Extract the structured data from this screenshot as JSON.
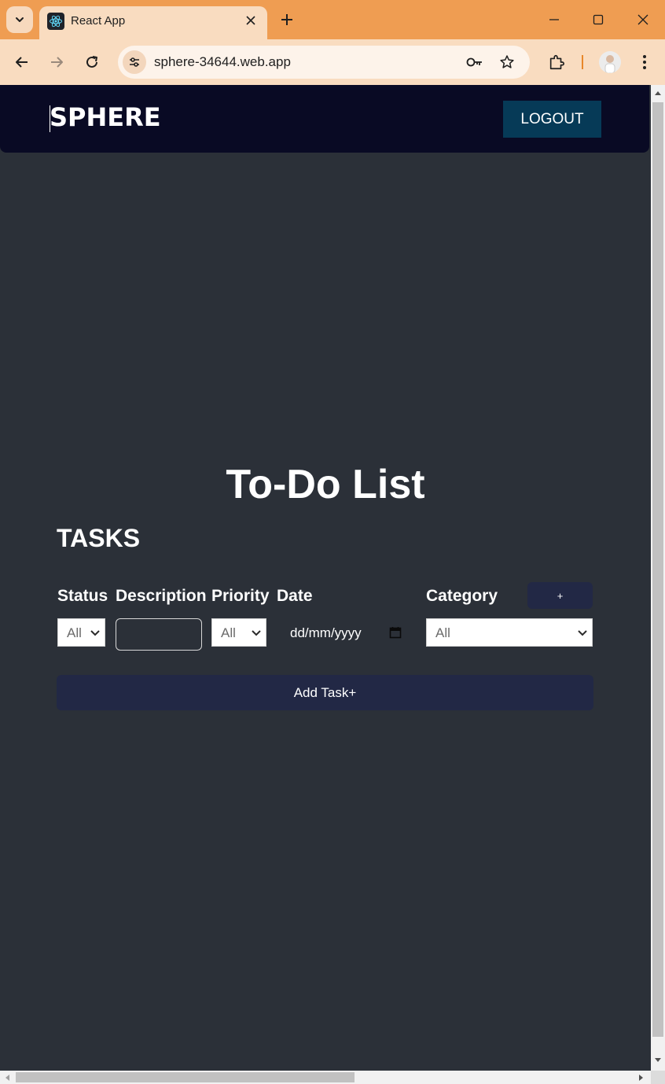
{
  "browser": {
    "tab_title": "React App",
    "url": "sphere-34644.web.app"
  },
  "app": {
    "brand": "SPHERE",
    "logout_label": "LOGOUT",
    "page_title": "To-Do List",
    "tasks_heading": "TASKS"
  },
  "form": {
    "labels": {
      "status": "Status",
      "description": "Description",
      "priority": "Priority",
      "date": "Date",
      "category": "Category"
    },
    "status_value": "All",
    "description_value": "",
    "priority_value": "All",
    "date_placeholder": "dd/mm/yyyy",
    "category_value": "All",
    "add_category_label": "+",
    "add_task_label": "Add Task+"
  },
  "colors": {
    "page_bg": "#2b3038",
    "navbar_bg": "#090a24",
    "logout_bg": "#063a57",
    "button_bg": "#222845",
    "browser_frame": "#ef9d52"
  }
}
